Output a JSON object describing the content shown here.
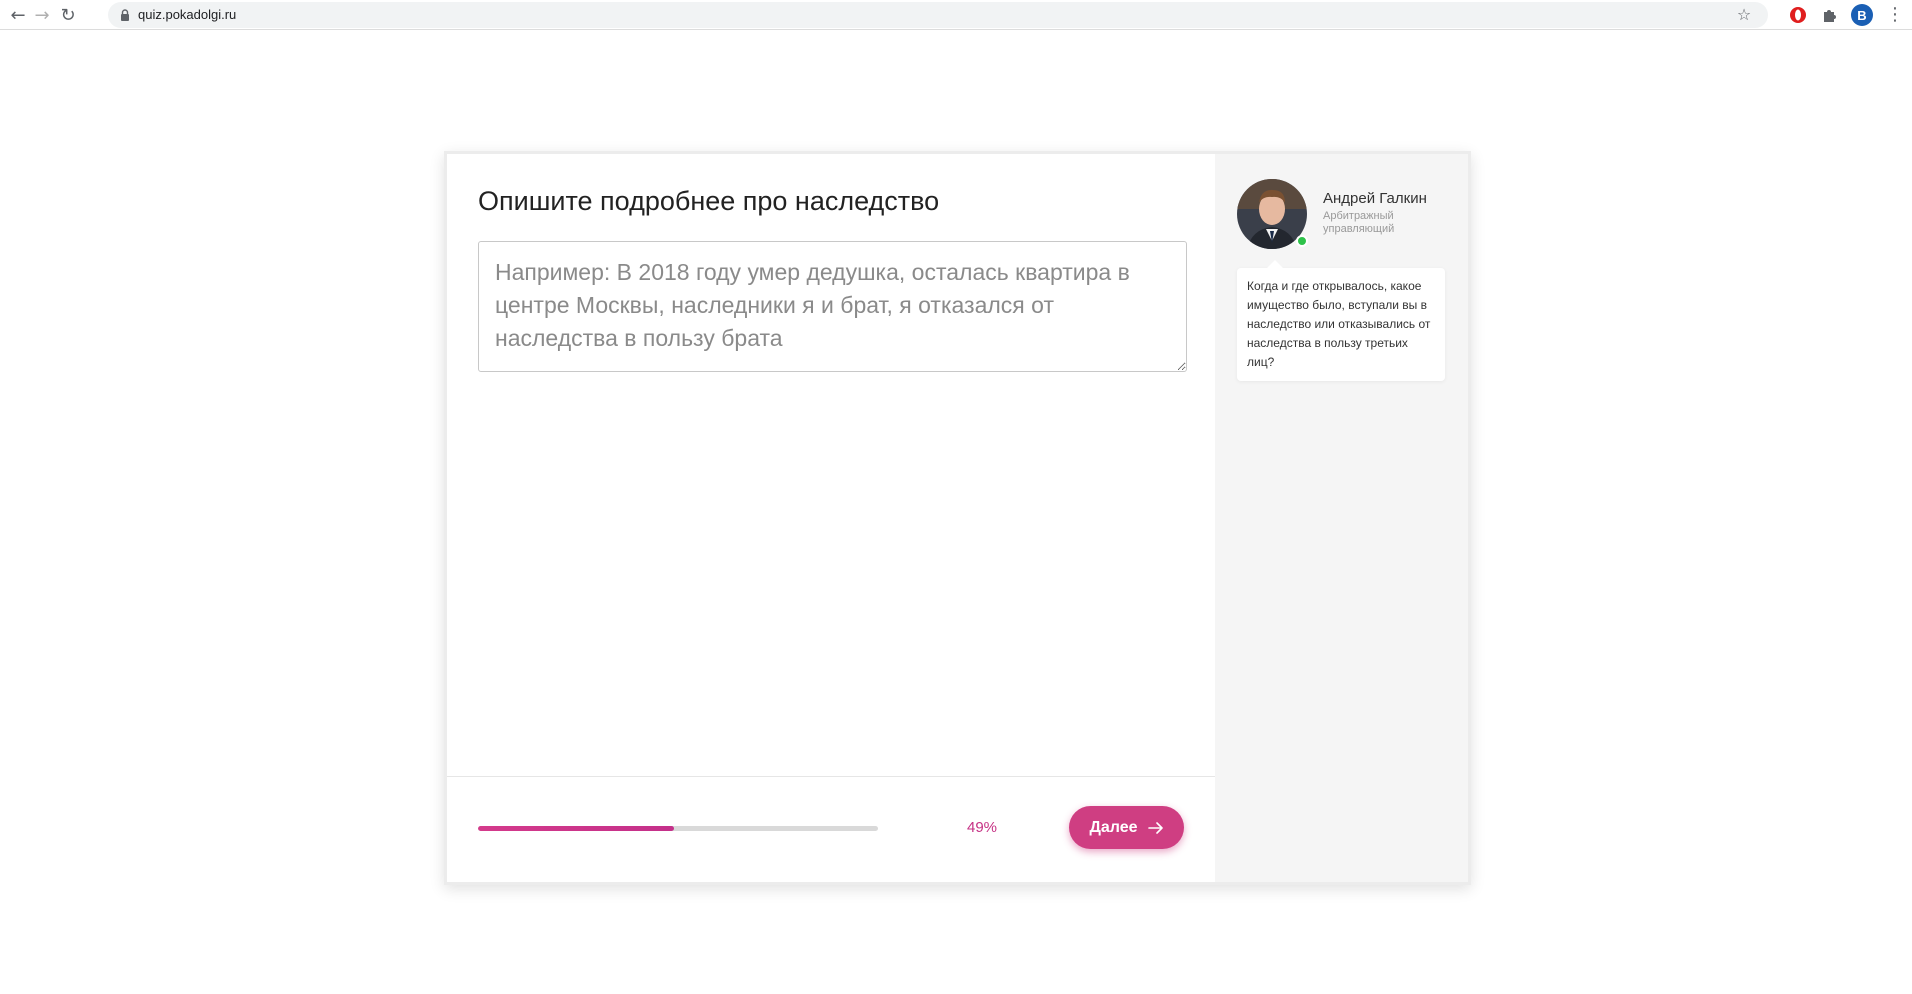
{
  "browser": {
    "url": "quiz.pokadolgi.ru",
    "profile_initial": "B",
    "nav_back_icon": "arrow-back-icon",
    "nav_forward_icon": "arrow-forward-icon",
    "reload_icon": "reload-icon"
  },
  "quiz": {
    "question_title": "Опишите подробнее про наследство",
    "answer_placeholder": "Например: В 2018 году умер дедушка, осталась квартира в центре Москвы, наследники я и брат, я отказался от наследства в пользу брата",
    "answer_value": "",
    "progress_percent": 49,
    "progress_label": "49%",
    "next_button_label": "Далее"
  },
  "expert": {
    "name": "Андрей Галкин",
    "role": "Арбитражный управляющий",
    "status": "online",
    "hint": "Когда и где открывалось, какое имущество было, вступали вы в наследство или отказывались от наследства в пользу третьих лиц?"
  },
  "colors": {
    "accent": "#cf3e82",
    "progress_fill": "#d43a8b",
    "progress_track": "#d9d9d9",
    "side_panel_bg": "#f5f5f5",
    "online": "#2ec24a"
  }
}
